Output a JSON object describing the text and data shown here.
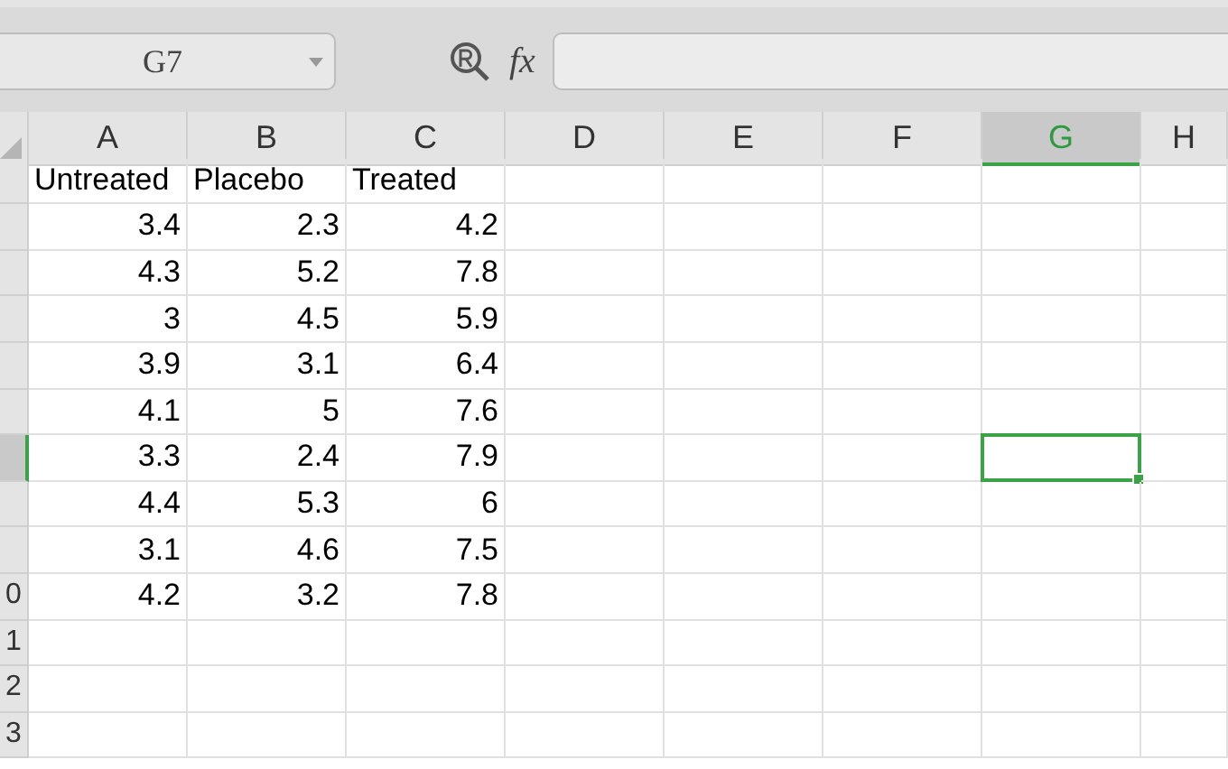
{
  "formula_bar": {
    "name_box": "G7",
    "function_label": "fx"
  },
  "columns": [
    {
      "label": "A",
      "selected": false
    },
    {
      "label": "B",
      "selected": false
    },
    {
      "label": "C",
      "selected": false
    },
    {
      "label": "D",
      "selected": false
    },
    {
      "label": "E",
      "selected": false
    },
    {
      "label": "F",
      "selected": false
    },
    {
      "label": "G",
      "selected": true
    },
    {
      "label": "H",
      "selected": false
    }
  ],
  "rows": [
    {
      "selected": false,
      "kind": "text",
      "cells": [
        "Untreated",
        "Placebo",
        "Treated"
      ]
    },
    {
      "selected": false,
      "kind": "number",
      "cells": [
        "3.4",
        "2.3",
        "4.2"
      ]
    },
    {
      "selected": false,
      "kind": "number",
      "cells": [
        "4.3",
        "5.2",
        "7.8"
      ]
    },
    {
      "selected": false,
      "kind": "number",
      "cells": [
        "3",
        "4.5",
        "5.9"
      ]
    },
    {
      "selected": false,
      "kind": "number",
      "cells": [
        "3.9",
        "3.1",
        "6.4"
      ]
    },
    {
      "selected": false,
      "kind": "number",
      "cells": [
        "4.1",
        "5",
        "7.6"
      ]
    },
    {
      "selected": true,
      "kind": "number",
      "cells": [
        "3.3",
        "2.4",
        "7.9"
      ]
    },
    {
      "selected": false,
      "kind": "number",
      "cells": [
        "4.4",
        "5.3",
        "6"
      ]
    },
    {
      "selected": false,
      "kind": "number",
      "cells": [
        "3.1",
        "4.6",
        "7.5"
      ]
    },
    {
      "selected": false,
      "kind": "number",
      "header": "0",
      "cells": [
        "4.2",
        "3.2",
        "7.8"
      ]
    },
    {
      "selected": false,
      "kind": "number",
      "header": "1",
      "cells": []
    },
    {
      "selected": false,
      "kind": "number",
      "header": "2",
      "cells": []
    },
    {
      "selected": false,
      "kind": "number",
      "header": "3",
      "cells": []
    }
  ]
}
